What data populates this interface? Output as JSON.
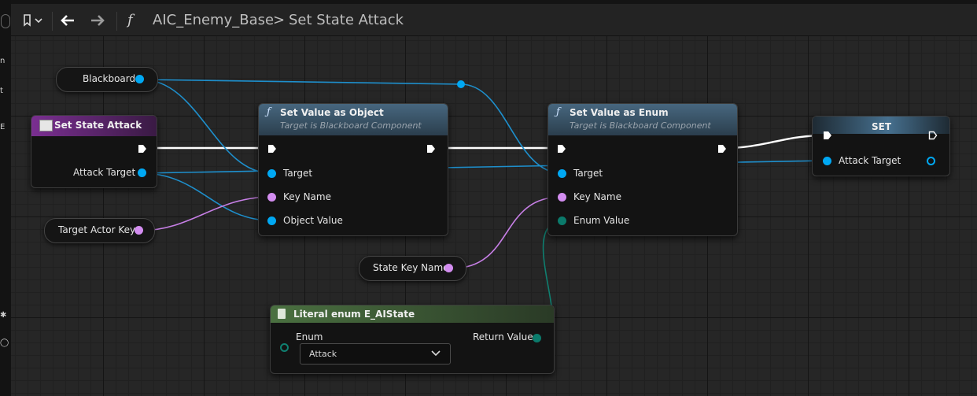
{
  "breadcrumb": {
    "function_glyph": "f",
    "blueprint_name": "AIC_Enemy_Base",
    "separator": ">",
    "function_name": "Set State Attack"
  },
  "icons": {
    "bookmark": "bookmark-icon",
    "back": "arrow-left-icon",
    "forward": "arrow-right-icon",
    "function": "function-icon"
  },
  "nodes": {
    "blackboard_var": {
      "label": "Blackboard"
    },
    "entry": {
      "title": "Set State Attack",
      "pin_attack_target": "Attack Target"
    },
    "target_actor_key_var": {
      "label": "Target Actor Key"
    },
    "set_value_object": {
      "title": "Set Value as Object",
      "subtitle": "Target is Blackboard Component",
      "pin_target": "Target",
      "pin_key_name": "Key Name",
      "pin_object_value": "Object Value"
    },
    "set_value_enum": {
      "title": "Set Value as Enum",
      "subtitle": "Target is Blackboard Component",
      "pin_target": "Target",
      "pin_key_name": "Key Name",
      "pin_enum_value": "Enum Value"
    },
    "set_node": {
      "title": "SET",
      "pin_attack_target": "Attack Target"
    },
    "state_key_name_var": {
      "label": "State Key Name"
    },
    "literal_enum": {
      "title": "Literal enum E_AIState",
      "pin_enum": "Enum",
      "pin_return": "Return Value",
      "enum_selected": "Attack"
    }
  },
  "colors": {
    "object_pin": "#00a8f3",
    "name_pin": "#d38df0",
    "enum_pin": "#0b7a6b",
    "exec_wire": "#ffffff",
    "function_header": "#3f5f78",
    "event_header": "#6a2a7c",
    "literal_header": "#466b3c"
  }
}
